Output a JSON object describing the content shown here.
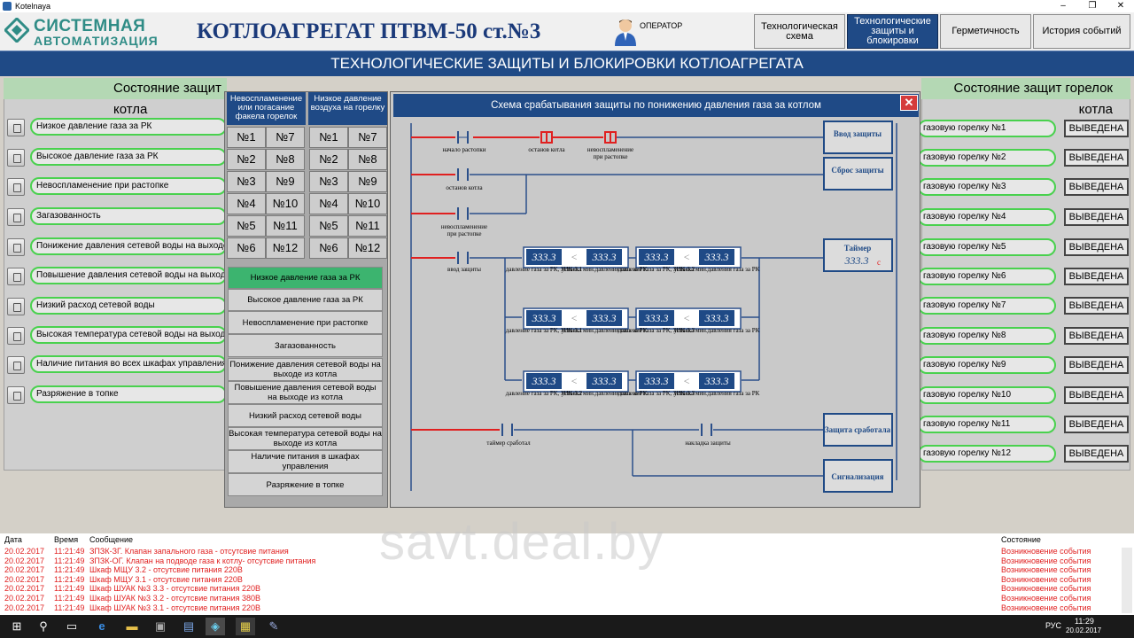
{
  "window": {
    "title": "Kotelnaya",
    "min": "–",
    "max": "❐",
    "close": "✕"
  },
  "header": {
    "logo_line1": "СИСТЕМНАЯ",
    "logo_line2": "АВТОМАТИЗАЦИЯ",
    "title": "КОТЛОАГРЕГАТ ПТВМ-50 ст.№3",
    "operator": "ОПЕРАТОР",
    "nav": [
      {
        "label": "Технологическая схема"
      },
      {
        "label": "Технологические защиты и блокировки"
      },
      {
        "label": "Герметичность"
      },
      {
        "label": "История событий"
      }
    ]
  },
  "banner": "ТЕХНОЛОГИЧЕСКИЕ ЗАЩИТЫ И БЛОКИРОВКИ КОТЛОАГРЕГАТА",
  "left": {
    "title": "Состояние защит котла",
    "items": [
      "Низкое давление газа за РК",
      "Высокое давление газа за РК",
      "Невоспламенение при растопке",
      "Загазованность",
      "Понижение давления сетевой воды на выходе",
      "Повышение давления сетевой воды на выходе",
      "Низкий расход сетевой воды",
      "Высокая температура сетевой воды на выходе",
      "Наличие питания во всех шкафах управления",
      "Разряжение в топке"
    ]
  },
  "right": {
    "title": "Состояние защит горелок котла",
    "items": [
      "газовую горелку №1",
      "газовую горелку №2",
      "газовую горелку №3",
      "газовую горелку №4",
      "газовую горелку №5",
      "газовую горелку №6",
      "газовую горелку №7",
      "газовую горелку №8",
      "газовую горелку №9",
      "газовую горелку №10",
      "газовую горелку №11",
      "газовую горелку №12"
    ],
    "status": "ВЫВЕДЕНА"
  },
  "selector": {
    "col1_head": "Невоспламенение или погасание факела горелок",
    "col2_head": "Низкое давление воздуха на горелку",
    "numbers": [
      "№1",
      "№7",
      "№2",
      "№8",
      "№3",
      "№9",
      "№4",
      "№10",
      "№5",
      "№11",
      "№6",
      "№12"
    ],
    "list": [
      "Низкое давление газа за РК",
      "Высокое давление газа за РК",
      "Невоспламенение при растопке",
      "Загазованность",
      "Понижение давления сетевой воды на выходе из котла",
      "Повышение давления сетевой воды на выходе из котла",
      "Низкий расход сетевой воды",
      "Высокая температура сетевой воды на выходе из котла",
      "Наличие питания в шкафах управления",
      "Разряжение в топке"
    ]
  },
  "scheme": {
    "title": "Схема срабатывания защиты по понижению давления газа за котлом",
    "close": "✕",
    "contacts": {
      "start": "начало растопки",
      "stop": "останов котла",
      "noflame": "невоспламенение при растопке",
      "stop2": "останов котла",
      "noflame2": "невоспламенение при растопке",
      "enable": "ввод защиты",
      "timer_done": "таймер сработал",
      "overlay": "накладка защиты"
    },
    "blocks": {
      "enable": "Ввод защиты",
      "reset": "Сброс защиты",
      "timer": "Таймер",
      "timer_val": "333.3",
      "timer_unit": "с",
      "tripped": "Защита сработала",
      "signal": "Сигнализация"
    },
    "value": "333.3",
    "lt": "<",
    "comparators": [
      {
        "p": "давление газа за РК, ЗИК-3.1",
        "s": "уставка мин.давления газа за РК"
      },
      {
        "p": "давление газа за РК, ЗИК-3.2",
        "s": "уставка мин.давления газа за РК"
      },
      {
        "p": "давление газа за РК, ЗИК-3.1",
        "s": "уставка мин.давления газа за РК"
      },
      {
        "p": "давление газа за РК, ЗИК-3.3",
        "s": "уставка мин.давления газа за РК"
      },
      {
        "p": "давление газа за РК, ЗИК-3.2",
        "s": "уставка мин.давления газа за РК"
      },
      {
        "p": "давление газа за РК, ЗИК-3.3",
        "s": "уставка мин.давления газа за РК"
      }
    ]
  },
  "log": {
    "headers": {
      "date": "Дата",
      "time": "Время",
      "msg": "Сообщение",
      "state": "Состояние"
    },
    "rows": [
      {
        "date": "20.02.2017",
        "time": "11:21:49",
        "msg": "ЗПЗК-ЗГ. Клапан запального газа - отсутсвие питания",
        "state": "Возникновение события"
      },
      {
        "date": "20.02.2017",
        "time": "11:21:49",
        "msg": "ЗПЗК-ОГ. Клапан на подводе газа к котлу- отсутсвие питания",
        "state": "Возникновение события"
      },
      {
        "date": "20.02.2017",
        "time": "11:21:49",
        "msg": "Шкаф МЩУ 3.2 - отсутсвие питания 220В",
        "state": "Возникновение события"
      },
      {
        "date": "20.02.2017",
        "time": "11:21:49",
        "msg": "Шкаф МЩУ 3.1 - отсутсвие питания 220В",
        "state": "Возникновение события"
      },
      {
        "date": "20.02.2017",
        "time": "11:21:49",
        "msg": "Шкаф ШУАК №3 3.3 - отсутсвие питания 220В",
        "state": "Возникновение события"
      },
      {
        "date": "20.02.2017",
        "time": "11:21:49",
        "msg": "Шкаф ШУАК №3 3.2 - отсутсвие питания 380В",
        "state": "Возникновение события"
      },
      {
        "date": "20.02.2017",
        "time": "11:21:49",
        "msg": "Шкаф ШУАК №3 3.1 - отсутсвие питания 220В",
        "state": "Возникновение события"
      }
    ]
  },
  "watermark": "savt.deal.by",
  "taskbar": {
    "lang": "РУС",
    "time": "11:29",
    "date": "20.02.2017"
  },
  "colors": {
    "accent": "#1f4a86",
    "ok_border": "#49d14e",
    "selected": "#3cb46f",
    "event_red": "#e02020",
    "line_red": "#e02020"
  }
}
